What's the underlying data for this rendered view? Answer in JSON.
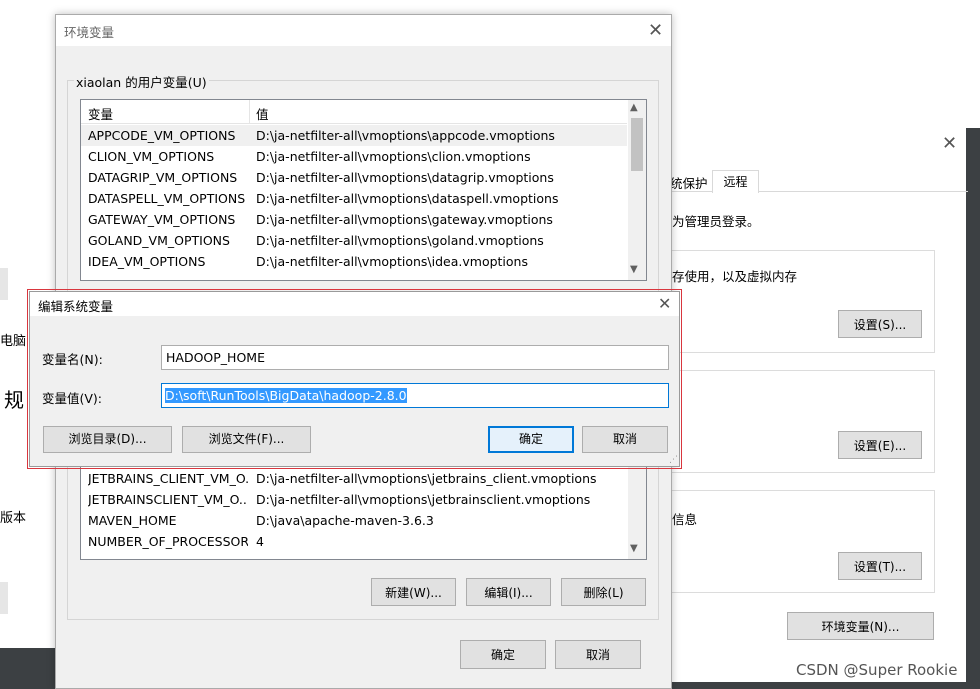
{
  "background": {
    "left_texts": [
      "电脑",
      "规",
      "版本"
    ],
    "sys_tabs": [
      "统保护",
      "远程"
    ],
    "admin_note": "为管理员登录。",
    "perf_note": "存使用，以及虚拟内存",
    "info_note": "信息",
    "settings_s": "设置(S)...",
    "settings_e": "设置(E)...",
    "settings_t": "设置(T)...",
    "env_button": "环境变量(N)..."
  },
  "env_dialog": {
    "title": "环境变量",
    "user_group_label": "xiaolan 的用户变量(U)",
    "col_name": "变量",
    "col_value": "值",
    "user_vars": [
      {
        "name": "APPCODE_VM_OPTIONS",
        "value": "D:\\ja-netfilter-all\\vmoptions\\appcode.vmoptions"
      },
      {
        "name": "CLION_VM_OPTIONS",
        "value": "D:\\ja-netfilter-all\\vmoptions\\clion.vmoptions"
      },
      {
        "name": "DATAGRIP_VM_OPTIONS",
        "value": "D:\\ja-netfilter-all\\vmoptions\\datagrip.vmoptions"
      },
      {
        "name": "DATASPELL_VM_OPTIONS",
        "value": "D:\\ja-netfilter-all\\vmoptions\\dataspell.vmoptions"
      },
      {
        "name": "GATEWAY_VM_OPTIONS",
        "value": "D:\\ja-netfilter-all\\vmoptions\\gateway.vmoptions"
      },
      {
        "name": "GOLAND_VM_OPTIONS",
        "value": "D:\\ja-netfilter-all\\vmoptions\\goland.vmoptions"
      },
      {
        "name": "IDEA_VM_OPTIONS",
        "value": "D:\\ja-netfilter-all\\vmoptions\\idea.vmoptions"
      }
    ],
    "sys_vars": [
      {
        "name": "JETBRAINS_CLIENT_VM_O...",
        "value": "D:\\ja-netfilter-all\\vmoptions\\jetbrains_client.vmoptions"
      },
      {
        "name": "JETBRAINSCLIENT_VM_O...",
        "value": "D:\\ja-netfilter-all\\vmoptions\\jetbrainsclient.vmoptions"
      },
      {
        "name": "MAVEN_HOME",
        "value": "D:\\java\\apache-maven-3.6.3"
      },
      {
        "name": "NUMBER_OF_PROCESSORS",
        "value": "4"
      }
    ],
    "btn_new": "新建(W)...",
    "btn_edit": "编辑(I)...",
    "btn_delete": "删除(L)",
    "btn_ok": "确定",
    "btn_cancel": "取消"
  },
  "edit_dialog": {
    "title": "编辑系统变量",
    "name_label": "变量名(N):",
    "name_value": "HADOOP_HOME",
    "value_label": "变量值(V):",
    "value_value": "D:\\soft\\RunTools\\BigData\\hadoop-2.8.0",
    "btn_browse_dir": "浏览目录(D)...",
    "btn_browse_file": "浏览文件(F)...",
    "btn_ok": "确定",
    "btn_cancel": "取消"
  },
  "watermark": "CSDN @Super Rookie",
  "colors": {
    "highlight": "#3399ff",
    "accent_red": "#d9363e",
    "selected_row": "#f0f0f0"
  }
}
